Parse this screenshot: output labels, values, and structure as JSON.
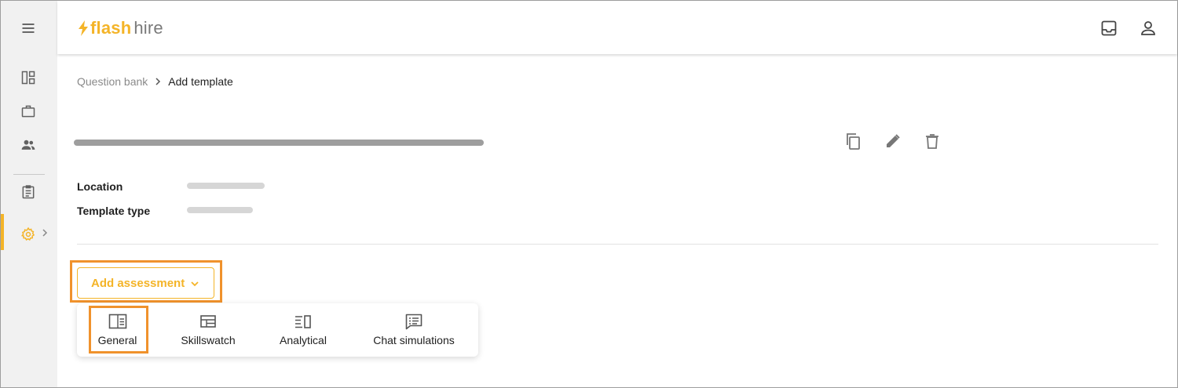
{
  "app": {
    "logo_primary": "flash",
    "logo_secondary": "hire",
    "accent_color": "#f4b428",
    "highlight_color": "#f0922c"
  },
  "sidebar": {
    "items": [
      {
        "icon": "dashboard-icon"
      },
      {
        "icon": "briefcase-icon"
      },
      {
        "icon": "people-icon"
      },
      {
        "icon": "clipboard-icon"
      },
      {
        "icon": "gear-icon",
        "active": true
      }
    ]
  },
  "header": {
    "icons": [
      "inbox-icon",
      "user-icon"
    ]
  },
  "breadcrumb": {
    "parent": "Question bank",
    "current": "Add template"
  },
  "template": {
    "actions": [
      "copy-icon",
      "edit-icon",
      "delete-icon"
    ],
    "fields": [
      {
        "label": "Location"
      },
      {
        "label": "Template type"
      }
    ]
  },
  "assessment": {
    "button_label": "Add assessment",
    "menu": [
      {
        "label": "General",
        "icon": "general-icon"
      },
      {
        "label": "Skillswatch",
        "icon": "skillswatch-icon"
      },
      {
        "label": "Analytical",
        "icon": "analytical-icon"
      },
      {
        "label": "Chat simulations",
        "icon": "chat-icon"
      }
    ]
  }
}
